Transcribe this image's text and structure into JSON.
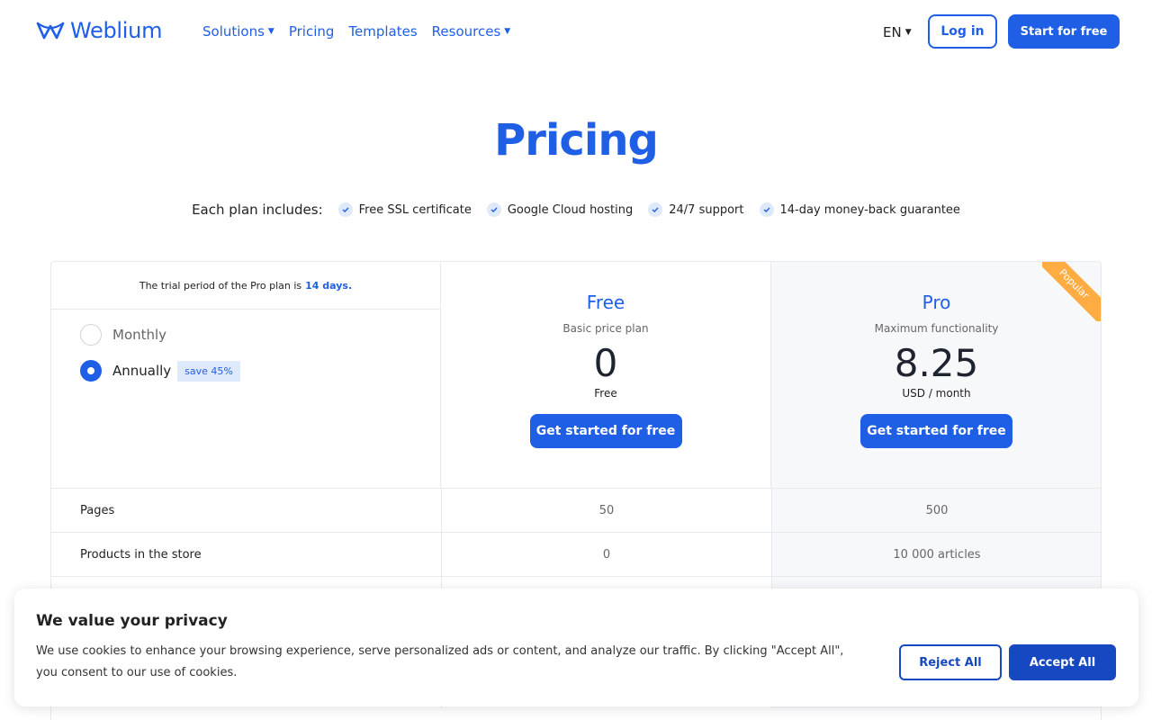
{
  "header": {
    "logo_text": "Weblium",
    "nav": [
      {
        "label": "Solutions",
        "has_dropdown": true
      },
      {
        "label": "Pricing",
        "has_dropdown": false
      },
      {
        "label": "Templates",
        "has_dropdown": false
      },
      {
        "label": "Resources",
        "has_dropdown": true
      }
    ],
    "language": "EN",
    "login_label": "Log in",
    "start_label": "Start for free"
  },
  "page_title": "Pricing",
  "includes": {
    "label": "Each plan includes:",
    "items": [
      "Free SSL certificate",
      "Google Cloud hosting",
      "24/7 support",
      "14-day money-back guarantee"
    ]
  },
  "table": {
    "trial_text": "The trial period of the Pro plan is",
    "trial_highlight": "14 days.",
    "billing": {
      "monthly_label": "Monthly",
      "annually_label": "Annually",
      "selected": "annually",
      "save_badge": "save 45%"
    },
    "plans": [
      {
        "name": "Free",
        "subtitle": "Basic price plan",
        "price": "0",
        "unit": "Free",
        "button": "Get started for free"
      },
      {
        "name": "Pro",
        "subtitle": "Maximum functionality",
        "price": "8.25",
        "unit": "USD / month",
        "button": "Get started for free",
        "ribbon": "Popular"
      }
    ],
    "features": [
      {
        "name": "Pages",
        "free": "50",
        "pro": "500"
      },
      {
        "name": "Products in the store",
        "free": "0",
        "pro": "10 000 articles"
      },
      {
        "name": "",
        "free": "",
        "pro": ""
      },
      {
        "name": "",
        "free": "",
        "pro": ""
      },
      {
        "name": "",
        "free": "",
        "pro": ""
      }
    ]
  },
  "cookie": {
    "title": "We value your privacy",
    "text": "We use cookies to enhance your browsing experience, serve personalized ads or content, and analyze our traffic. By clicking \"Accept All\", you consent to our use of cookies.",
    "reject_label": "Reject All",
    "accept_label": "Accept All"
  },
  "colors": {
    "brand": "#1f5fe6",
    "cookie_button": "#1648c2",
    "ribbon": "#ffad42"
  }
}
